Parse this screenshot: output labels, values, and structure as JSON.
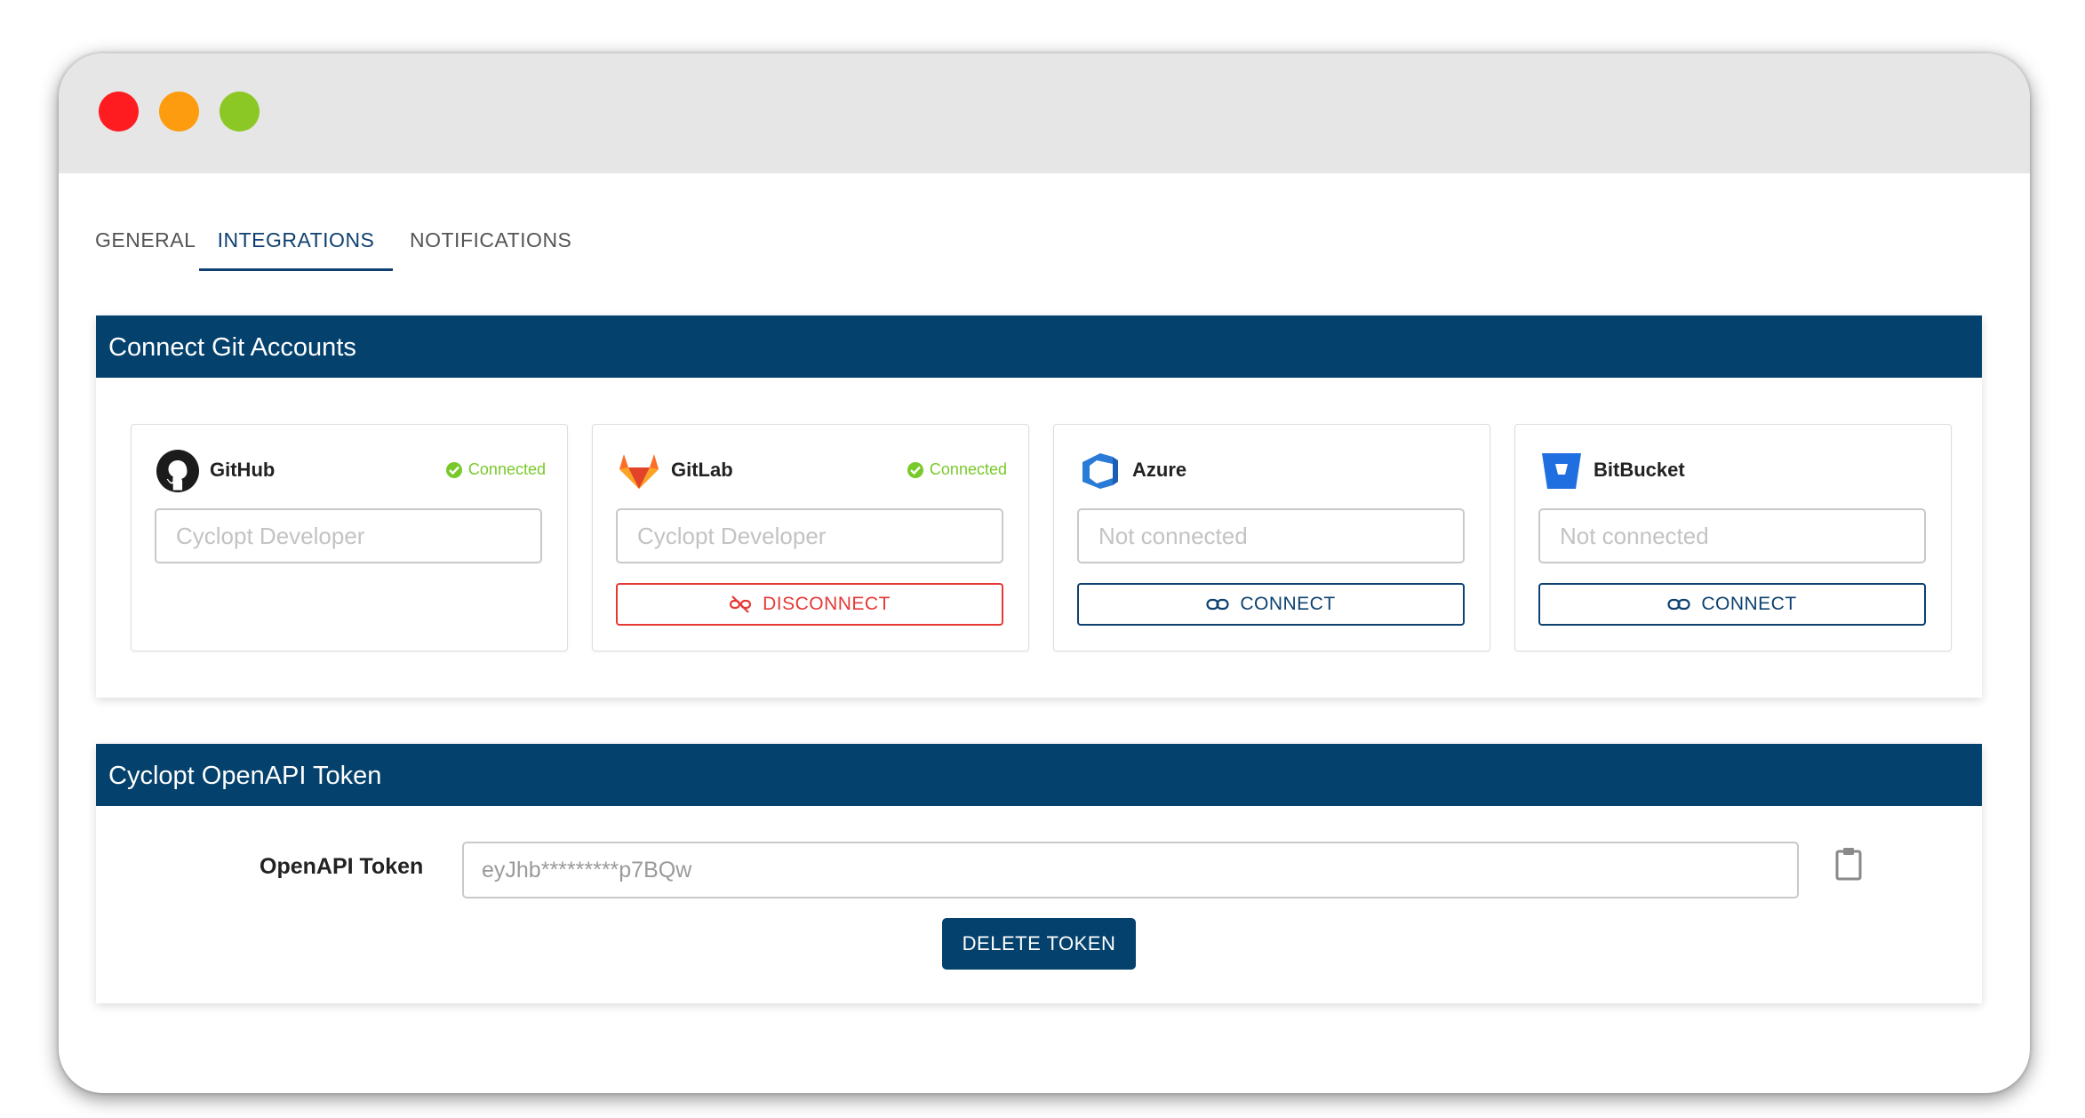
{
  "tabs": [
    {
      "label": "GENERAL",
      "active": false
    },
    {
      "label": "INTEGRATIONS",
      "active": true
    },
    {
      "label": "NOTIFICATIONS",
      "active": false
    }
  ],
  "git_panel": {
    "title": "Connect Git Accounts",
    "cards": [
      {
        "name": "GitHub",
        "icon": "github-icon",
        "status": "Connected",
        "value": "",
        "placeholder": "Cyclopt Developer",
        "button": null
      },
      {
        "name": "GitLab",
        "icon": "gitlab-icon",
        "status": "Connected",
        "value": "",
        "placeholder": "Cyclopt Developer",
        "button": "DISCONNECT"
      },
      {
        "name": "Azure",
        "icon": "azure-icon",
        "status": "",
        "value": "",
        "placeholder": "Not connected",
        "button": "CONNECT"
      },
      {
        "name": "BitBucket",
        "icon": "bitbucket-icon",
        "status": "",
        "value": "",
        "placeholder": "Not connected",
        "button": "CONNECT"
      }
    ]
  },
  "token_panel": {
    "title": "Cyclopt OpenAPI Token",
    "label": "OpenAPI Token",
    "value": "eyJhb*********p7BQw",
    "delete_label": "DELETE TOKEN"
  },
  "colors": {
    "header_bg": "#04416d",
    "connected_green": "#79c92a",
    "disconnect_red": "#e53935",
    "close_light": "#fe1c20",
    "minimize_light": "#fd9c0f",
    "maximize_light": "#8bc826"
  }
}
